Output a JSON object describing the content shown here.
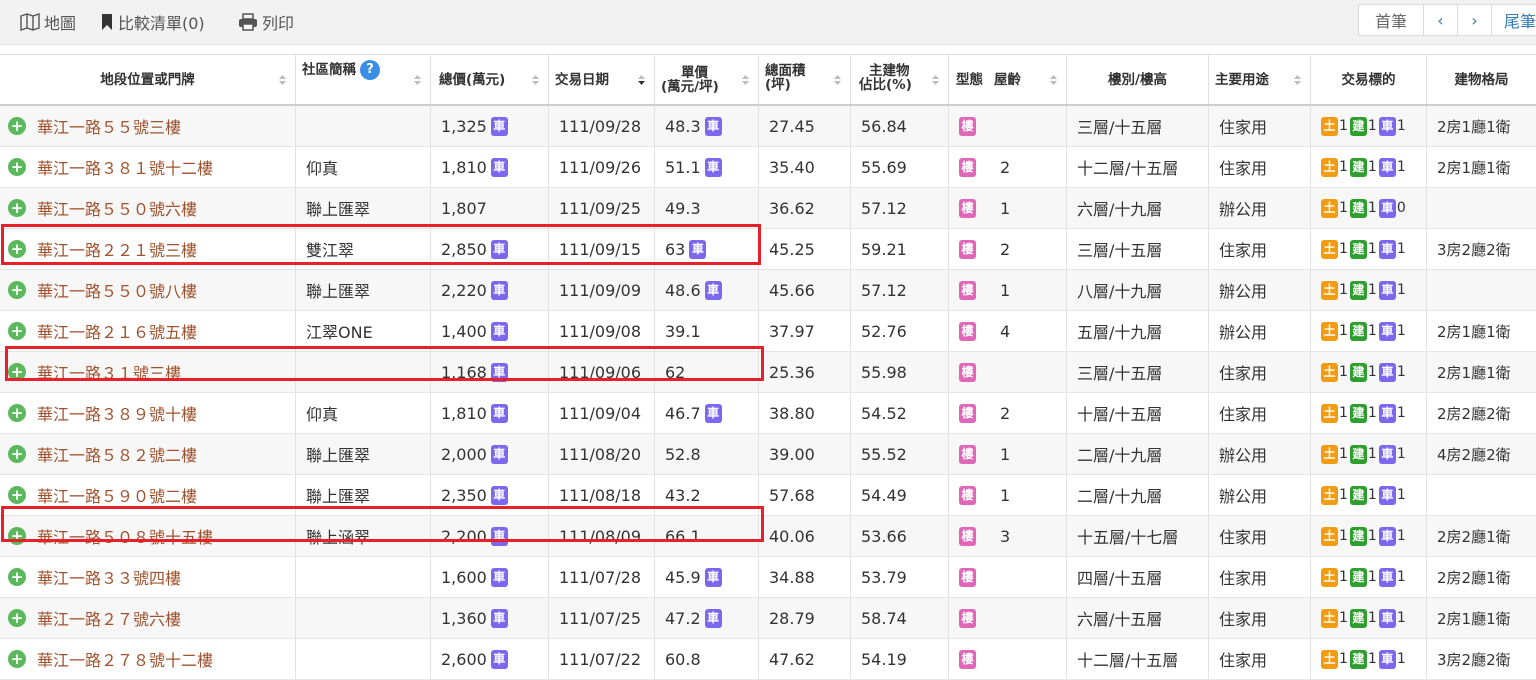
{
  "toolbar": {
    "map_label": "地圖",
    "compare_label": "比較清單(0)",
    "print_label": "列印"
  },
  "pager": {
    "first": "首筆",
    "prev": "‹",
    "next": "›",
    "last": "尾筆"
  },
  "columns": {
    "address": "地段位置或門牌",
    "community": "社區簡稱",
    "total_price": "總價(萬元)",
    "trade_date": "交易日期",
    "unit_price_1": "單價",
    "unit_price_2": "(萬元/坪)",
    "area_1": "總面積",
    "area_2": "(坪)",
    "main_ratio_1": "主建物",
    "main_ratio_2": "佔比(%)",
    "type": "型態",
    "age": "屋齡",
    "floor": "樓別/樓高",
    "usage": "主要用途",
    "target": "交易標的",
    "layout": "建物格局"
  },
  "badges": {
    "car": "車",
    "type": "樓",
    "land": "土",
    "building": "建",
    "parking": "車"
  },
  "rows": [
    {
      "address": "華江一路５５號三樓",
      "community": "",
      "total": "1,325",
      "total_car": true,
      "date": "111/09/28",
      "unit": "48.3",
      "unit_car": true,
      "area": "27.45",
      "ratio": "56.84",
      "age": "",
      "floor": "三層/十五層",
      "usage": "住家用",
      "land": "1",
      "bldg": "1",
      "park": "1",
      "layout": "2房1廳1衛"
    },
    {
      "address": "華江一路３８１號十二樓",
      "community": "仰真",
      "total": "1,810",
      "total_car": true,
      "date": "111/09/26",
      "unit": "51.1",
      "unit_car": true,
      "area": "35.40",
      "ratio": "55.69",
      "age": "2",
      "floor": "十二層/十五層",
      "usage": "住家用",
      "land": "1",
      "bldg": "1",
      "park": "1",
      "layout": "2房1廳1衛"
    },
    {
      "address": "華江一路５５０號六樓",
      "community": "聯上匯翠",
      "total": "1,807",
      "total_car": false,
      "date": "111/09/25",
      "unit": "49.3",
      "unit_car": false,
      "area": "36.62",
      "ratio": "57.12",
      "age": "1",
      "floor": "六層/十九層",
      "usage": "辦公用",
      "land": "1",
      "bldg": "1",
      "park": "0",
      "layout": ""
    },
    {
      "address": "華江一路２２１號三樓",
      "community": "雙江翠",
      "total": "2,850",
      "total_car": true,
      "date": "111/09/15",
      "unit": "63",
      "unit_car": true,
      "area": "45.25",
      "ratio": "59.21",
      "age": "2",
      "floor": "三層/十五層",
      "usage": "住家用",
      "land": "1",
      "bldg": "1",
      "park": "1",
      "layout": "3房2廳2衛"
    },
    {
      "address": "華江一路５５０號八樓",
      "community": "聯上匯翠",
      "total": "2,220",
      "total_car": true,
      "date": "111/09/09",
      "unit": "48.6",
      "unit_car": true,
      "area": "45.66",
      "ratio": "57.12",
      "age": "1",
      "floor": "八層/十九層",
      "usage": "辦公用",
      "land": "1",
      "bldg": "1",
      "park": "1",
      "layout": ""
    },
    {
      "address": "華江一路２１６號五樓",
      "community": "江翠ONE",
      "total": "1,400",
      "total_car": true,
      "date": "111/09/08",
      "unit": "39.1",
      "unit_car": false,
      "area": "37.97",
      "ratio": "52.76",
      "age": "4",
      "floor": "五層/十九層",
      "usage": "辦公用",
      "land": "1",
      "bldg": "1",
      "park": "1",
      "layout": "2房1廳1衛"
    },
    {
      "address": "華江一路３１號三樓",
      "community": "",
      "total": "1,168",
      "total_car": true,
      "date": "111/09/06",
      "unit": "62",
      "unit_car": false,
      "area": "25.36",
      "ratio": "55.98",
      "age": "",
      "floor": "三層/十五層",
      "usage": "住家用",
      "land": "1",
      "bldg": "1",
      "park": "1",
      "layout": "2房1廳1衛"
    },
    {
      "address": "華江一路３８９號十樓",
      "community": "仰真",
      "total": "1,810",
      "total_car": true,
      "date": "111/09/04",
      "unit": "46.7",
      "unit_car": true,
      "area": "38.80",
      "ratio": "54.52",
      "age": "2",
      "floor": "十層/十五層",
      "usage": "住家用",
      "land": "1",
      "bldg": "1",
      "park": "1",
      "layout": "2房2廳2衛"
    },
    {
      "address": "華江一路５８２號二樓",
      "community": "聯上匯翠",
      "total": "2,000",
      "total_car": true,
      "date": "111/08/20",
      "unit": "52.8",
      "unit_car": false,
      "area": "39.00",
      "ratio": "55.52",
      "age": "1",
      "floor": "二層/十九層",
      "usage": "辦公用",
      "land": "1",
      "bldg": "1",
      "park": "1",
      "layout": "4房2廳2衛"
    },
    {
      "address": "華江一路５９０號二樓",
      "community": "聯上匯翠",
      "total": "2,350",
      "total_car": true,
      "date": "111/08/18",
      "unit": "43.2",
      "unit_car": false,
      "area": "57.68",
      "ratio": "54.49",
      "age": "1",
      "floor": "二層/十九層",
      "usage": "辦公用",
      "land": "1",
      "bldg": "1",
      "park": "1",
      "layout": ""
    },
    {
      "address": "華江一路５０８號十五樓",
      "community": "聯上涵翠",
      "total": "2,200",
      "total_car": true,
      "date": "111/08/09",
      "unit": "66.1",
      "unit_car": false,
      "area": "40.06",
      "ratio": "53.66",
      "age": "3",
      "floor": "十五層/十七層",
      "usage": "住家用",
      "land": "1",
      "bldg": "1",
      "park": "1",
      "layout": "2房2廳1衛"
    },
    {
      "address": "華江一路３３號四樓",
      "community": "",
      "total": "1,600",
      "total_car": true,
      "date": "111/07/28",
      "unit": "45.9",
      "unit_car": true,
      "area": "34.88",
      "ratio": "53.79",
      "age": "",
      "floor": "四層/十五層",
      "usage": "住家用",
      "land": "1",
      "bldg": "1",
      "park": "1",
      "layout": "2房2廳1衛"
    },
    {
      "address": "華江一路２７號六樓",
      "community": "",
      "total": "1,360",
      "total_car": true,
      "date": "111/07/25",
      "unit": "47.2",
      "unit_car": true,
      "area": "28.79",
      "ratio": "58.74",
      "age": "",
      "floor": "六層/十五層",
      "usage": "住家用",
      "land": "1",
      "bldg": "1",
      "park": "1",
      "layout": "2房1廳1衛"
    },
    {
      "address": "華江一路２７８號十二樓",
      "community": "",
      "total": "2,600",
      "total_car": true,
      "date": "111/07/22",
      "unit": "60.8",
      "unit_car": false,
      "area": "47.62",
      "ratio": "54.19",
      "age": "",
      "floor": "十二層/十五層",
      "usage": "住家用",
      "land": "1",
      "bldg": "1",
      "park": "1",
      "layout": "3房2廳2衛"
    }
  ]
}
